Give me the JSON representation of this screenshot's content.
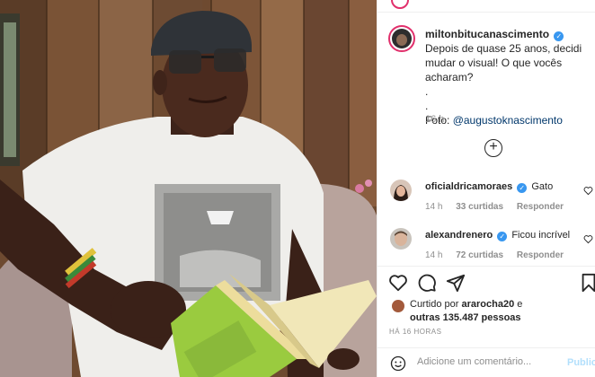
{
  "post": {
    "photo_alt": "milton-nascimento-photo",
    "author": {
      "username": "miltonbitucanascimento",
      "verified_mark": "✓",
      "caption_line1": "Depois de quase 25 anos, decidi mudar o visual! O que vocês acharam?",
      "caption_dot1": ".",
      "caption_dot2": ".",
      "photo_credit_prefix": "Foto: ",
      "photo_credit_mention": "@augustoknascimento",
      "time": "16 h"
    },
    "load_more_label": "+",
    "comments": [
      {
        "username": "oficialdricamoraes",
        "verified_mark": "✓",
        "text": "Gato",
        "time": "14 h",
        "likes": "33 curtidas",
        "reply": "Responder"
      },
      {
        "username": "alexandrenero",
        "verified_mark": "✓",
        "text": "Ficou incrível",
        "time": "14 h",
        "likes": "72 curtidas",
        "reply": "Responder"
      }
    ],
    "liked_by": {
      "prefix": "Curtido por ",
      "user": "ararocha20",
      "middle": " e",
      "others": "outras 135.487 pessoas"
    },
    "post_age": "HÁ 16 HORAS",
    "add_comment": {
      "placeholder": "Adicione um comentário...",
      "publish_label": "Publicar"
    },
    "icons": {
      "like": "heart-icon",
      "comment": "comment-icon",
      "share": "share-icon",
      "save": "bookmark-icon",
      "emoji": "emoji-icon"
    },
    "colors": {
      "verified": "#3897f0",
      "mention": "#00376b",
      "meta": "#8e8e8e",
      "publish_disabled": "#b2dffc"
    }
  }
}
